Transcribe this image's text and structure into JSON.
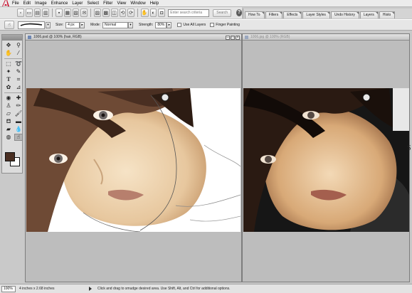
{
  "menu": [
    "File",
    "Edit",
    "Image",
    "Enhance",
    "Layer",
    "Select",
    "Filter",
    "View",
    "Window",
    "Help"
  ],
  "search": {
    "placeholder": "Enter search criteria",
    "button": "Search"
  },
  "palette_tabs": [
    "How To",
    "Filters",
    "Effects",
    "Layer Styles",
    "Undo History",
    "Layers",
    "Histo"
  ],
  "options": {
    "size_label": "Size:",
    "size_value": "4 px",
    "mode_label": "Mode:",
    "mode_value": "Normal",
    "strength_label": "Strength:",
    "strength_value": "80%",
    "use_all_layers": "Use All Layers",
    "finger_painting": "Finger Painting"
  },
  "documents": [
    {
      "title": "1006.psd @ 100% (hair, RGB)",
      "active": true
    },
    {
      "title": "1006.jpg @ 100% (RGB)",
      "active": false
    }
  ],
  "status": {
    "zoom": "100%",
    "doc_size": "4 inches x 2.68 inches",
    "hint": "Click and drag to smudge desired area. Use Shift, Alt, and Ctrl for additional options."
  },
  "colors": {
    "foreground": "#4a2f22",
    "background": "#ffffff",
    "accent": "#6f87b2"
  },
  "icons": {
    "tools": [
      "move-icon",
      "zoom-icon",
      "hand-icon",
      "eyedropper-icon",
      "marquee-icon",
      "lasso-icon",
      "magic-wand-icon",
      "selection-brush-icon",
      "type-icon",
      "crop-icon",
      "cookie-cutter-icon",
      "straighten-icon",
      "red-eye-icon",
      "healing-brush-icon",
      "clone-stamp-icon",
      "pencil-icon",
      "eraser-icon",
      "brush-icon",
      "paint-bucket-icon",
      "gradient-icon",
      "shape-icon",
      "blur-icon",
      "sponge-icon",
      "smudge-icon"
    ]
  }
}
